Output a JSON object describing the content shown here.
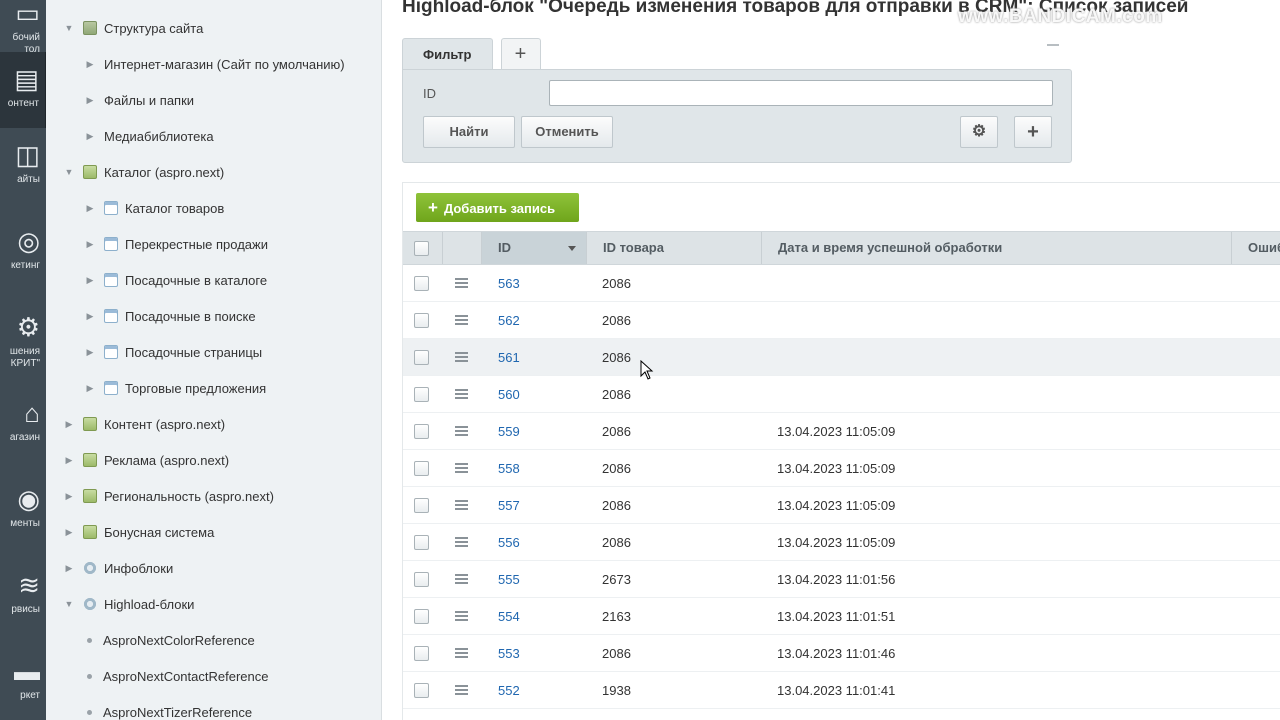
{
  "rail": {
    "items": [
      {
        "label": "бочий\nтол",
        "icon": "desktop-icon",
        "glyph": "▭"
      },
      {
        "label": "онтент",
        "icon": "content-icon",
        "glyph": "▤",
        "active": true
      },
      {
        "label": "айты",
        "icon": "sites-icon",
        "glyph": "◫"
      },
      {
        "label": "кетинг",
        "icon": "marketing-icon",
        "glyph": "◎"
      },
      {
        "label": "шения\nКРИТ\"",
        "icon": "solutions-icon",
        "glyph": "⚙"
      },
      {
        "label": "агазин",
        "icon": "shop-icon",
        "glyph": "⌂"
      },
      {
        "label": "менты",
        "icon": "clients-icon",
        "glyph": "◉"
      },
      {
        "label": "рвисы",
        "icon": "services-icon",
        "glyph": "≋"
      },
      {
        "label": "ркет",
        "icon": "market-icon",
        "glyph": "▬"
      }
    ]
  },
  "tree": {
    "nodes": [
      {
        "label": "Структура сайта",
        "level": 0,
        "arrow": "▼",
        "icon": "struct"
      },
      {
        "label": "Интернет-магазин (Сайт по умолчанию)",
        "level": 1,
        "arrow": "▶",
        "icon": ""
      },
      {
        "label": "Файлы и папки",
        "level": 1,
        "arrow": "▶",
        "icon": ""
      },
      {
        "label": "Медиабиблиотека",
        "level": 1,
        "arrow": "▶",
        "icon": ""
      },
      {
        "label": "Каталог (aspro.next)",
        "level": 0,
        "arrow": "▼",
        "icon": "block"
      },
      {
        "label": "Каталог товаров",
        "level": 1,
        "arrow": "▶",
        "icon": "list"
      },
      {
        "label": "Перекрестные продажи",
        "level": 1,
        "arrow": "▶",
        "icon": "list"
      },
      {
        "label": "Посадочные в каталоге",
        "level": 1,
        "arrow": "▶",
        "icon": "list"
      },
      {
        "label": "Посадочные в поиске",
        "level": 1,
        "arrow": "▶",
        "icon": "list"
      },
      {
        "label": "Посадочные страницы",
        "level": 1,
        "arrow": "▶",
        "icon": "list"
      },
      {
        "label": "Торговые предложения",
        "level": 1,
        "arrow": "▶",
        "icon": "list"
      },
      {
        "label": "Контент (aspro.next)",
        "level": 0,
        "arrow": "▶",
        "icon": "block"
      },
      {
        "label": "Реклама (aspro.next)",
        "level": 0,
        "arrow": "▶",
        "icon": "block"
      },
      {
        "label": "Региональность (aspro.next)",
        "level": 0,
        "arrow": "▶",
        "icon": "block"
      },
      {
        "label": "Бонусная система",
        "level": 0,
        "arrow": "▶",
        "icon": "block"
      },
      {
        "label": "Инфоблоки",
        "level": 0,
        "arrow": "▶",
        "icon": "gear"
      },
      {
        "label": "Highload-блоки",
        "level": 0,
        "arrow": "▼",
        "icon": "gear"
      },
      {
        "label": "AsproNextColorReference",
        "level": 2,
        "arrow": "",
        "icon": "dot"
      },
      {
        "label": "AsproNextContactReference",
        "level": 2,
        "arrow": "",
        "icon": "dot"
      },
      {
        "label": "AsproNextTizerReference",
        "level": 2,
        "arrow": "",
        "icon": "dot"
      }
    ]
  },
  "page": {
    "title": "Highload-блок \"Очередь изменения товаров для отправки в CRM\": Список записей",
    "watermark": "www.BANDICAM.com"
  },
  "filter": {
    "tab_label": "Фильтр",
    "add_tab_label": "+",
    "field_label": "ID",
    "field_value": "",
    "find_label": "Найти",
    "cancel_label": "Отменить",
    "settings_glyph": "⚙",
    "add_glyph": "+"
  },
  "grid": {
    "add_label": "Добавить запись",
    "add_plus": "+",
    "columns": {
      "id": "ID",
      "product_id": "ID товара",
      "date": "Дата и время успешной обработки",
      "error": "Ошиб"
    },
    "rows": [
      {
        "id": "563",
        "product_id": "2086",
        "date": ""
      },
      {
        "id": "562",
        "product_id": "2086",
        "date": ""
      },
      {
        "id": "561",
        "product_id": "2086",
        "date": ""
      },
      {
        "id": "560",
        "product_id": "2086",
        "date": ""
      },
      {
        "id": "559",
        "product_id": "2086",
        "date": "13.04.2023 11:05:09"
      },
      {
        "id": "558",
        "product_id": "2086",
        "date": "13.04.2023 11:05:09"
      },
      {
        "id": "557",
        "product_id": "2086",
        "date": "13.04.2023 11:05:09"
      },
      {
        "id": "556",
        "product_id": "2086",
        "date": "13.04.2023 11:05:09"
      },
      {
        "id": "555",
        "product_id": "2673",
        "date": "13.04.2023 11:01:56"
      },
      {
        "id": "554",
        "product_id": "2163",
        "date": "13.04.2023 11:01:51"
      },
      {
        "id": "553",
        "product_id": "2086",
        "date": "13.04.2023 11:01:46"
      },
      {
        "id": "552",
        "product_id": "1938",
        "date": "13.04.2023 11:01:41"
      }
    ]
  }
}
